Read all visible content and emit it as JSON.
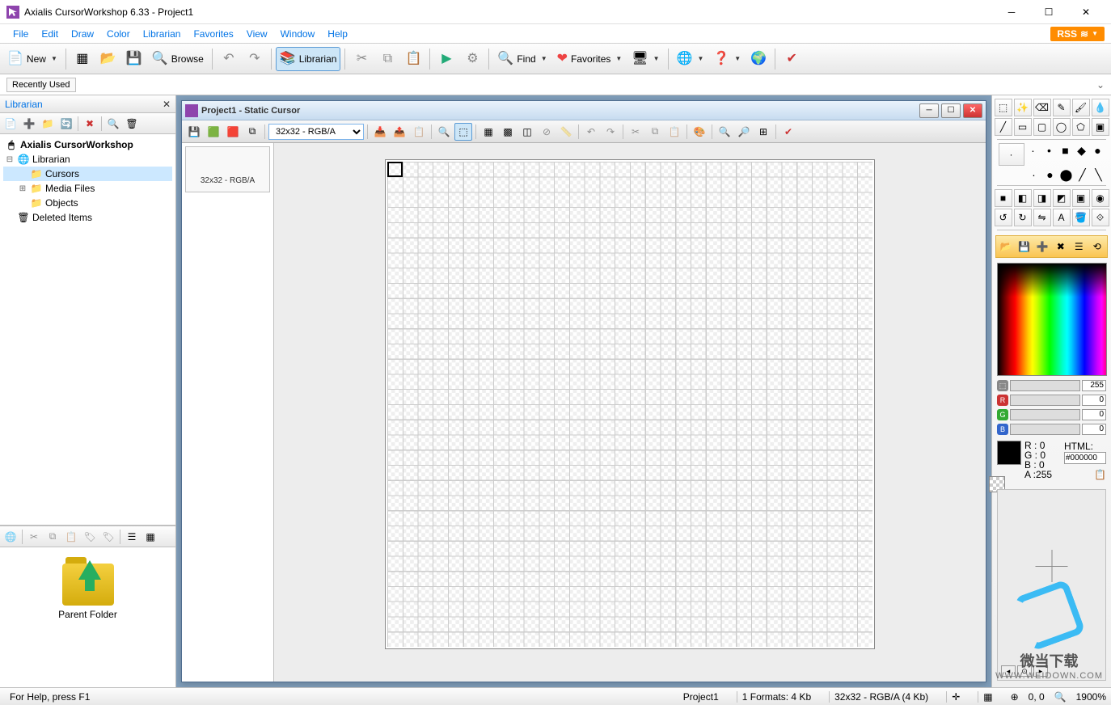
{
  "titlebar": {
    "app": "Axialis CursorWorkshop 6.33 - Project1"
  },
  "menu": {
    "file": "File",
    "edit": "Edit",
    "draw": "Draw",
    "color": "Color",
    "librarian": "Librarian",
    "favorites": "Favorites",
    "view": "View",
    "window": "Window",
    "help": "Help",
    "rss": "RSS"
  },
  "toolbar": {
    "new": "New",
    "browse": "Browse",
    "librarian": "Librarian",
    "find": "Find",
    "favorites": "Favorites"
  },
  "recent": {
    "label": "Recently Used"
  },
  "librarian_panel": {
    "title": "Librarian",
    "tree": {
      "root": "Axialis CursorWorkshop",
      "lib": "Librarian",
      "cursors": "Cursors",
      "media": "Media Files",
      "objects": "Objects",
      "deleted": "Deleted Items"
    },
    "parent": "Parent Folder"
  },
  "doc": {
    "title": "Project1 - Static Cursor",
    "size_select": "32x32 - RGB/A",
    "frame_label": "32x32 - RGB/A"
  },
  "color": {
    "opacity_label": "Opacity",
    "opacity": "255",
    "r_label": "Red",
    "r": "0",
    "g_label": "Green",
    "g": "0",
    "b_label": "Blue",
    "b": "0",
    "R": "R :",
    "G": "G :",
    "B": "B :",
    "A": "A :",
    "Rv": "0",
    "Gv": "0",
    "Bv": "0",
    "Av": "255",
    "html_label": "HTML:",
    "html": "#000000"
  },
  "status": {
    "help": "For Help, press F1",
    "project": "Project1",
    "formats": "1 Formats: 4 Kb",
    "imgfmt": "32x32 - RGB/A (4 Kb)",
    "coords": "0, 0",
    "zoom": "1900%"
  },
  "watermark": {
    "text": "微当下载",
    "url": "WWW.WEIDOWN.COM"
  }
}
